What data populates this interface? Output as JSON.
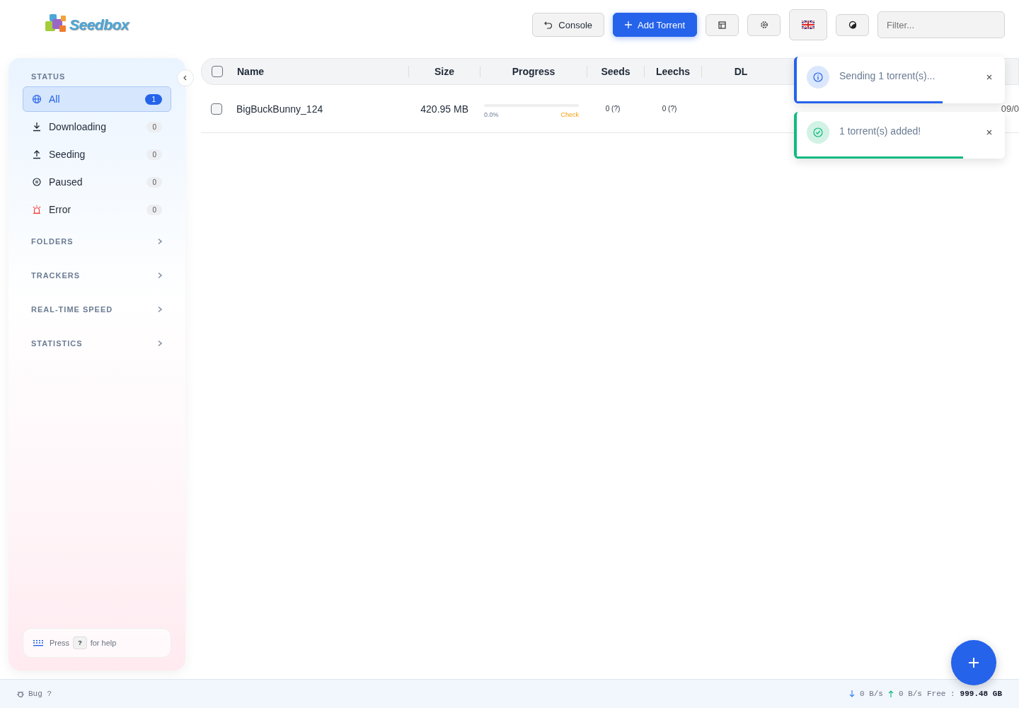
{
  "logo": {
    "text": "Seedbox"
  },
  "toolbar": {
    "console": "Console",
    "add": "Add Torrent",
    "filter": {
      "placeholder": "Filter..."
    }
  },
  "sidebar": {
    "status_title": "STATUS",
    "items": [
      {
        "label": "All",
        "count": "1",
        "kind": "all",
        "selected": true
      },
      {
        "label": "Downloading",
        "count": "0",
        "kind": "down",
        "selected": false
      },
      {
        "label": "Seeding",
        "count": "0",
        "kind": "up",
        "selected": false
      },
      {
        "label": "Paused",
        "count": "0",
        "kind": "pause",
        "selected": false
      },
      {
        "label": "Error",
        "count": "0",
        "kind": "error",
        "selected": false
      }
    ],
    "sections": [
      {
        "label": "FOLDERS",
        "expanded": false
      },
      {
        "label": "TRACKERS",
        "expanded": false
      },
      {
        "label": "REAL-TIME SPEED",
        "expanded": false
      },
      {
        "label": "STATISTICS",
        "expanded": false
      }
    ],
    "help": {
      "before": "Press",
      "key": "?",
      "after": "for help"
    }
  },
  "table": {
    "columns": [
      "Name",
      "Size",
      "Progress",
      "Seeds",
      "Leechs",
      "DL"
    ],
    "all_checked": false,
    "rows": [
      {
        "checked": false,
        "name": "BigBuckBunny_124",
        "size": "420.95 MB",
        "level": 0.0,
        "percent": "0.0%",
        "state": "Check",
        "seeds": "0 (?)",
        "leechs": "0 (?)",
        "date": "09/0"
      }
    ]
  },
  "toasts": [
    {
      "kind": "info",
      "text": "Sending 1 torrent(s)...",
      "level": 0.7
    },
    {
      "kind": "success",
      "text": "1 torrent(s) added!",
      "level": 0.8
    }
  ],
  "status_bar": {
    "bug": "Bug ?",
    "down": "0 B/s",
    "up": "0 B/s",
    "free_label": "Free :",
    "free": "999.48 GB"
  }
}
